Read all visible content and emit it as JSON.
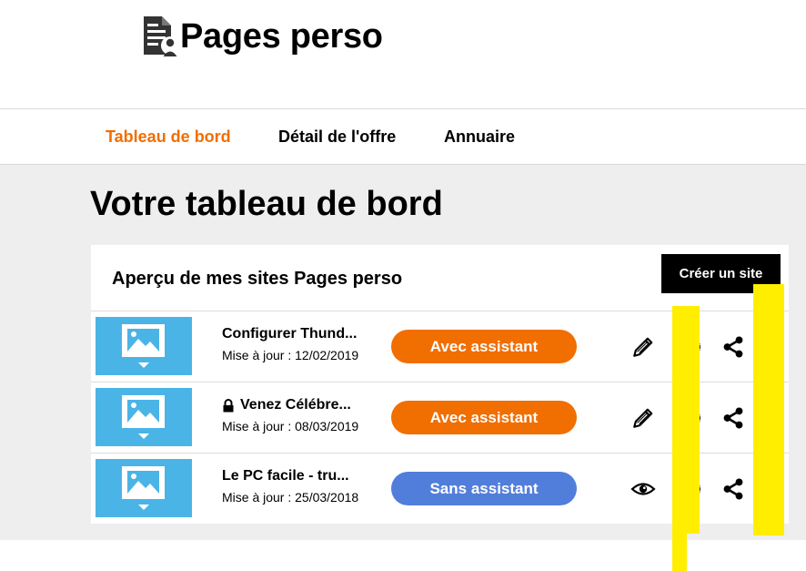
{
  "header": {
    "title": "Pages perso"
  },
  "nav": {
    "tabs": [
      {
        "label": "Tableau de bord",
        "active": true
      },
      {
        "label": "Détail de l'offre",
        "active": false
      },
      {
        "label": "Annuaire",
        "active": false
      }
    ]
  },
  "main": {
    "title": "Votre tableau de bord",
    "card": {
      "title": "Aperçu de mes sites Pages perso",
      "create_label": "Créer un site",
      "rows": [
        {
          "name": "Configurer Thund...",
          "locked": false,
          "updated": "Mise à jour : 12/02/2019",
          "mode": "Avec assistant",
          "mode_color": "#f16e00",
          "action_icon": "pencil-icon"
        },
        {
          "name": "Venez Célébre...",
          "locked": true,
          "updated": "Mise à jour : 08/03/2019",
          "mode": "Avec assistant",
          "mode_color": "#f16e00",
          "action_icon": "pencil-icon"
        },
        {
          "name": "Le PC facile - tru...",
          "locked": false,
          "updated": "Mise à jour : 25/03/2018",
          "mode": "Sans assistant",
          "mode_color": "#527edb",
          "action_icon": "eye-icon"
        }
      ]
    }
  },
  "colors": {
    "accent": "#f16e00",
    "secondary": "#527edb",
    "thumbnail": "#4bb4e6",
    "highlight": "#ffee00"
  }
}
